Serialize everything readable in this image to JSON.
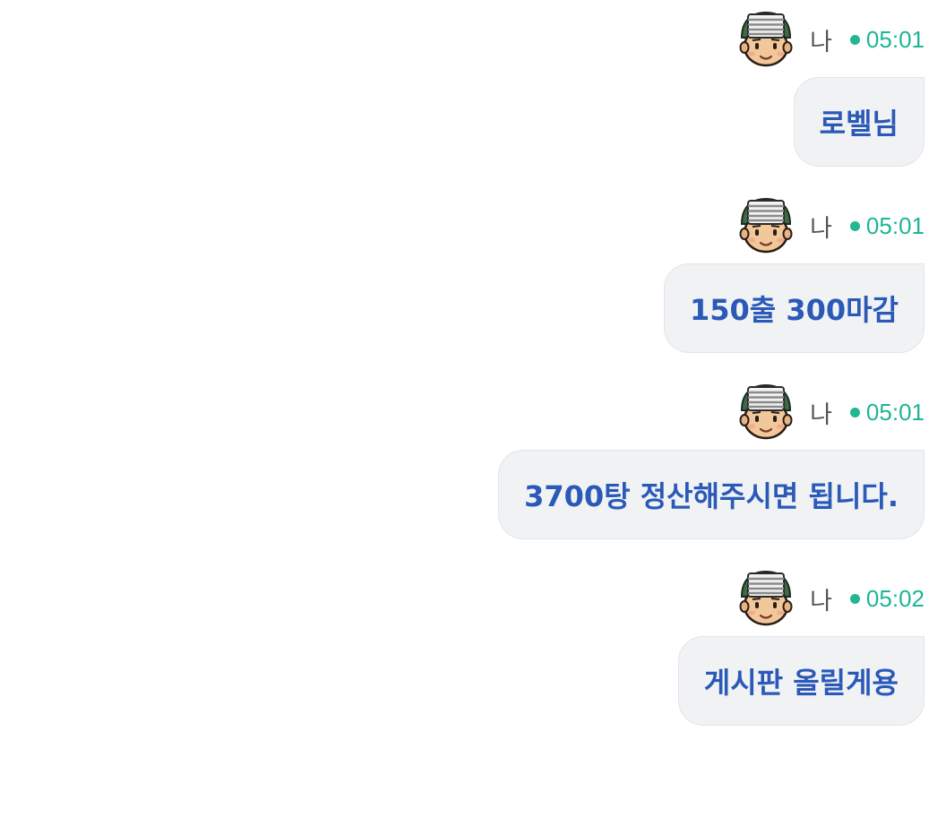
{
  "messages": [
    {
      "sender": "나",
      "time": "05:01",
      "text": "로벨님"
    },
    {
      "sender": "나",
      "time": "05:01",
      "text": "150출 300마감"
    },
    {
      "sender": "나",
      "time": "05:01",
      "text": "3700탕 정산해주시면 됩니다."
    },
    {
      "sender": "나",
      "time": "05:02",
      "text": "게시판 올릴게용"
    }
  ],
  "colors": {
    "bubble_bg": "#f0f2f4",
    "bubble_text": "#2a59b8",
    "time_text": "#1fb597",
    "status_dot": "#22b790",
    "name_text": "#555555"
  },
  "icons": {
    "avatar": "soldier-face-avatar-icon",
    "status": "online-dot-icon"
  }
}
